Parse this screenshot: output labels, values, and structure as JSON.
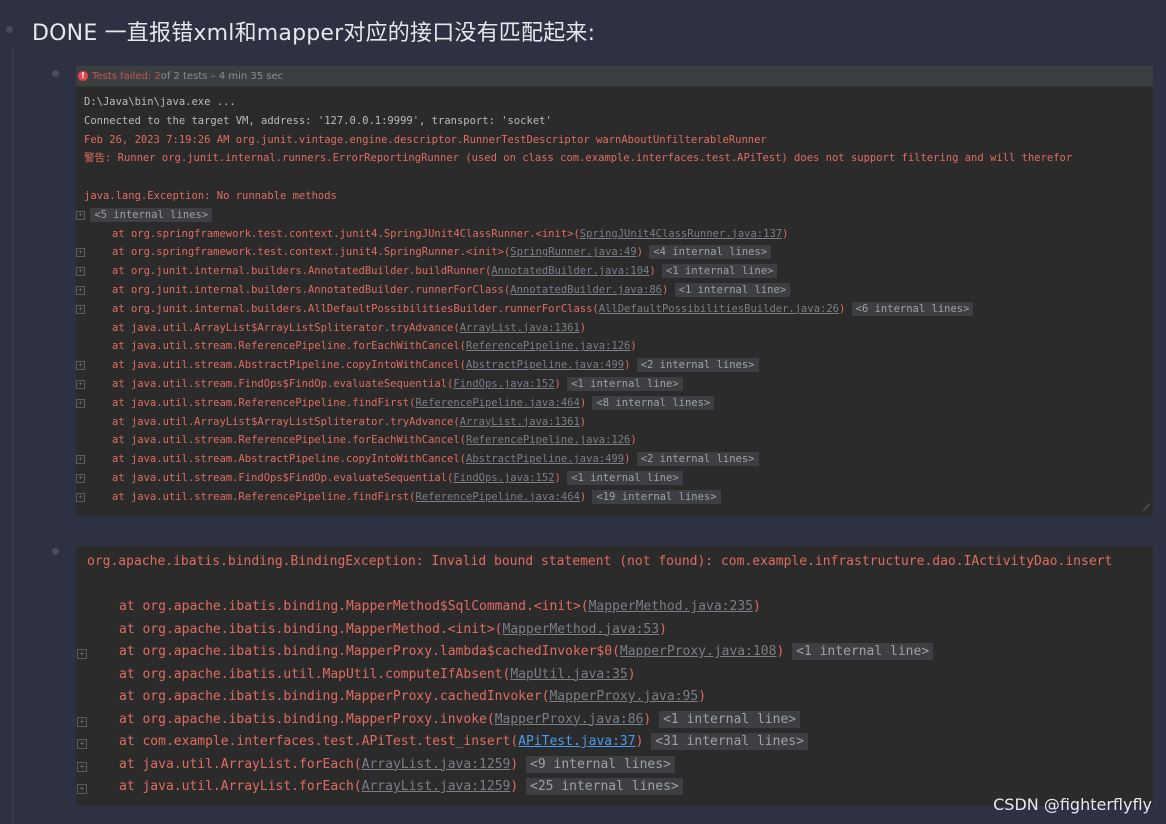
{
  "page": {
    "title": "DONE 一直报错xml和mapper对应的接口没有匹配起来:",
    "watermark": "CSDN @fighterflyfly"
  },
  "test_header": {
    "icon": "error-circle-icon",
    "failed_label": "Tests failed: 2",
    "rest": " of 2 tests – 4 min 35 sec"
  },
  "console1": {
    "lines": [
      {
        "type": "plain",
        "text": "D:\\Java\\bin\\java.exe ..."
      },
      {
        "type": "plain",
        "text": "Connected to the target VM, address: '127.0.0.1:9999', transport: 'socket'"
      },
      {
        "type": "red",
        "text": "Feb 26, 2023 7:19:26 AM org.junit.vintage.engine.descriptor.RunnerTestDescriptor warnAboutUnfilterableRunner"
      },
      {
        "type": "red",
        "text": "警告: Runner org.junit.internal.runners.ErrorReportingRunner (used on class com.example.interfaces.test.APiTest) does not support filtering and will therefor"
      },
      {
        "type": "blank",
        "text": ""
      },
      {
        "type": "red",
        "text": "java.lang.Exception: No runnable methods"
      },
      {
        "type": "fold",
        "fold": "<5 internal lines>"
      }
    ],
    "frames": [
      {
        "at": "at org.springframework.test.context.junit4.SpringJUnit4ClassRunner.<init>(",
        "link": "SpringJUnit4ClassRunner.java:137",
        "fold": "",
        "plus": false
      },
      {
        "at": "at org.springframework.test.context.junit4.SpringRunner.<init>(",
        "link": "SpringRunner.java:49",
        "fold": "<4 internal lines>",
        "plus": true
      },
      {
        "at": "at org.junit.internal.builders.AnnotatedBuilder.buildRunner(",
        "link": "AnnotatedBuilder.java:104",
        "fold": "<1 internal line>",
        "plus": true
      },
      {
        "at": "at org.junit.internal.builders.AnnotatedBuilder.runnerForClass(",
        "link": "AnnotatedBuilder.java:86",
        "fold": "<1 internal line>",
        "plus": true
      },
      {
        "at": "at org.junit.internal.builders.AllDefaultPossibilitiesBuilder.runnerForClass(",
        "link": "AllDefaultPossibilitiesBuilder.java:26",
        "fold": "<6 internal lines>",
        "plus": true
      },
      {
        "at": "at java.util.ArrayList$ArrayListSpliterator.tryAdvance(",
        "link": "ArrayList.java:1361",
        "fold": "",
        "plus": false
      },
      {
        "at": "at java.util.stream.ReferencePipeline.forEachWithCancel(",
        "link": "ReferencePipeline.java:126",
        "fold": "",
        "plus": false
      },
      {
        "at": "at java.util.stream.AbstractPipeline.copyIntoWithCancel(",
        "link": "AbstractPipeline.java:499",
        "fold": "<2 internal lines>",
        "plus": true
      },
      {
        "at": "at java.util.stream.FindOps$FindOp.evaluateSequential(",
        "link": "FindOps.java:152",
        "fold": "<1 internal line>",
        "plus": true
      },
      {
        "at": "at java.util.stream.ReferencePipeline.findFirst(",
        "link": "ReferencePipeline.java:464",
        "fold": "<8 internal lines>",
        "plus": true
      },
      {
        "at": "at java.util.ArrayList$ArrayListSpliterator.tryAdvance(",
        "link": "ArrayList.java:1361",
        "fold": "",
        "plus": false
      },
      {
        "at": "at java.util.stream.ReferencePipeline.forEachWithCancel(",
        "link": "ReferencePipeline.java:126",
        "fold": "",
        "plus": false
      },
      {
        "at": "at java.util.stream.AbstractPipeline.copyIntoWithCancel(",
        "link": "AbstractPipeline.java:499",
        "fold": "<2 internal lines>",
        "plus": true
      },
      {
        "at": "at java.util.stream.FindOps$FindOp.evaluateSequential(",
        "link": "FindOps.java:152",
        "fold": "<1 internal line>",
        "plus": true
      },
      {
        "at": "at java.util.stream.ReferencePipeline.findFirst(",
        "link": "ReferencePipeline.java:464",
        "fold": "<19 internal lines>",
        "plus": true
      }
    ]
  },
  "console2": {
    "exception": "org.apache.ibatis.binding.BindingException: Invalid bound statement (not found): com.example.infrastructure.dao.IActivityDao.insert",
    "frames": [
      {
        "at": "at org.apache.ibatis.binding.MapperMethod$SqlCommand.<init>(",
        "link": "MapperMethod.java:235",
        "fold": "",
        "plus": false,
        "blue": false
      },
      {
        "at": "at org.apache.ibatis.binding.MapperMethod.<init>(",
        "link": "MapperMethod.java:53",
        "fold": "",
        "plus": false,
        "blue": false
      },
      {
        "at": "at org.apache.ibatis.binding.MapperProxy.lambda$cachedInvoker$0(",
        "link": "MapperProxy.java:108",
        "fold": "<1 internal line>",
        "plus": true,
        "blue": false
      },
      {
        "at": "at org.apache.ibatis.util.MapUtil.computeIfAbsent(",
        "link": "MapUtil.java:35",
        "fold": "",
        "plus": false,
        "blue": false
      },
      {
        "at": "at org.apache.ibatis.binding.MapperProxy.cachedInvoker(",
        "link": "MapperProxy.java:95",
        "fold": "",
        "plus": false,
        "blue": false
      },
      {
        "at": "at org.apache.ibatis.binding.MapperProxy.invoke(",
        "link": "MapperProxy.java:86",
        "fold": "<1 internal line>",
        "plus": true,
        "blue": false
      },
      {
        "at": "at com.example.interfaces.test.APiTest.test_insert(",
        "link": "APiTest.java:37",
        "fold": "<31 internal lines>",
        "plus": true,
        "blue": true
      },
      {
        "at": "at java.util.ArrayList.forEach(",
        "link": "ArrayList.java:1259",
        "fold": "<9 internal lines>",
        "plus": true,
        "blue": false
      },
      {
        "at": "at java.util.ArrayList.forEach(",
        "link": "ArrayList.java:1259",
        "fold": "<25 internal lines>",
        "plus": true,
        "blue": false
      }
    ]
  },
  "colors": {
    "page_bg": "#2d3142",
    "console_bg": "#2b2b2b",
    "error_red": "#e06c5f",
    "link_blue": "#4a9ce8"
  }
}
